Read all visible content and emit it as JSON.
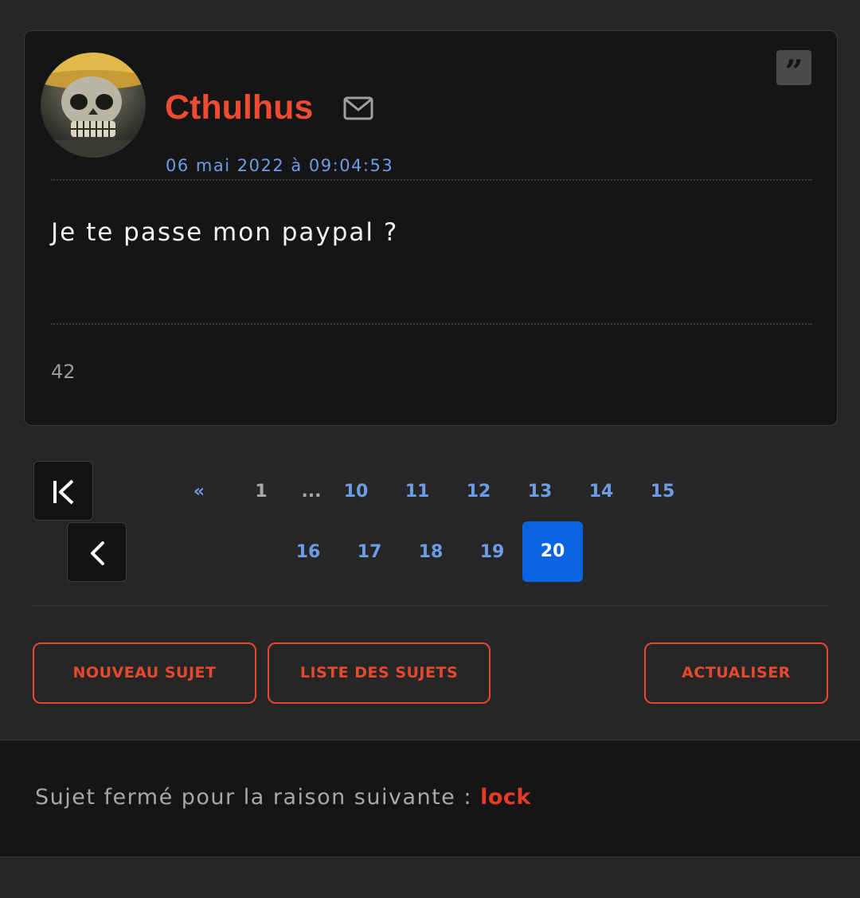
{
  "post": {
    "author": "Cthulhus",
    "date": "06 mai 2022 à 09:04:53",
    "message": "Je te passe mon paypal ?",
    "post_id": "42",
    "quote_glyph": "”",
    "icons": {
      "mail": "mail-icon",
      "quote": "quote-icon",
      "avatar": "skull-avatar"
    }
  },
  "pagination": {
    "prev_symbol": "«",
    "first_page": "1",
    "ellipsis": "...",
    "row1_pages": [
      "10",
      "11",
      "12",
      "13",
      "14",
      "15"
    ],
    "row2_pages": [
      "16",
      "17",
      "18",
      "19"
    ],
    "current_page": "20",
    "icons": {
      "first": "first-page-icon",
      "prev": "chevron-left-icon"
    }
  },
  "actions": {
    "new_topic": "NOUVEAU SUJET",
    "topic_list": "LISTE DES SUJETS",
    "refresh": "ACTUALISER"
  },
  "closed_notice": {
    "label": "Sujet fermé pour la raison suivante :",
    "reason": "lock"
  },
  "colors": {
    "background": "#262626",
    "panel": "#151515",
    "author": "#ee4b33",
    "link": "#6f9ce6",
    "current_page": "#0a63e0",
    "button_outline": "#e64a2e",
    "reason": "#e83a26"
  }
}
